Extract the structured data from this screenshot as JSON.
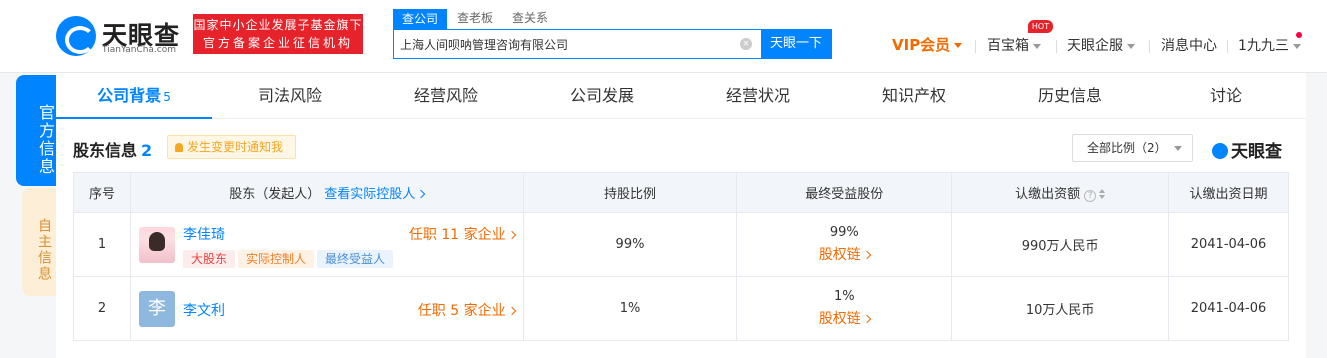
{
  "header": {
    "logo_name": "天眼查",
    "logo_sub": "TianYanCha.com",
    "badge_line1": "国家中小企业发展子基金旗下",
    "badge_line2": "官方备案企业征信机构",
    "search_tabs": [
      "查公司",
      "查老板",
      "查关系"
    ],
    "search_value": "上海人间呗呐管理咨询有限公司",
    "search_button": "天眼一下",
    "nav": {
      "vip": "VIP会员",
      "treasure": "百宝箱",
      "hot_badge": "HOT",
      "enterprise": "天眼企服",
      "messages": "消息中心",
      "user": "1九九三"
    }
  },
  "side_tabs": {
    "official": "官方信息",
    "self": "自主信息"
  },
  "tabs": [
    {
      "label": "公司背景",
      "count": "5"
    },
    {
      "label": "司法风险"
    },
    {
      "label": "经营风险"
    },
    {
      "label": "公司发展"
    },
    {
      "label": "经营状况"
    },
    {
      "label": "知识产权"
    },
    {
      "label": "历史信息"
    },
    {
      "label": "讨论"
    }
  ],
  "section": {
    "title": "股东信息",
    "count": "2",
    "notice": "发生变更时通知我",
    "ratio_select": "全部比例（2）",
    "brand": "天眼查"
  },
  "table": {
    "headers": {
      "index": "序号",
      "shareholder": "股东（发起人）",
      "controller_link": "查看实际控股人",
      "ratio": "持股比例",
      "benefit": "最终受益股份",
      "capital": "认缴出资额",
      "date": "认缴出资日期"
    },
    "rows": [
      {
        "index": "1",
        "name": "李佳琦",
        "job": "任职 11 家企业",
        "tags": [
          "大股东",
          "实际控制人",
          "最终受益人"
        ],
        "ratio": "99%",
        "benefit": "99%",
        "chain": "股权链",
        "capital": "990万人民币",
        "date": "2041-04-06"
      },
      {
        "index": "2",
        "avatar_char": "李",
        "name": "李文利",
        "job": "任职 5 家企业",
        "ratio": "1%",
        "benefit": "1%",
        "chain": "股权链",
        "capital": "10万人民币",
        "date": "2041-04-06"
      }
    ]
  }
}
